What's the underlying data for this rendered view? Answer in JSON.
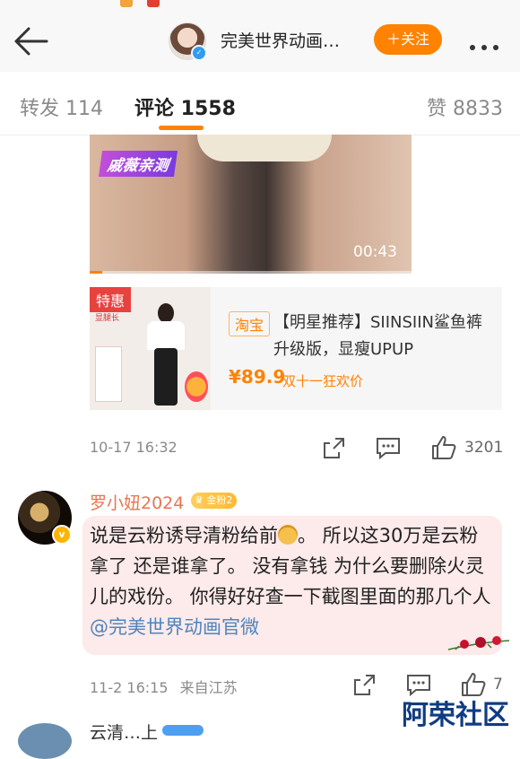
{
  "header": {
    "title": "完美世界动画…",
    "follow_label": "＋关注"
  },
  "tabs": [
    {
      "label": "转发 114"
    },
    {
      "label": "评论 1558"
    },
    {
      "label": "赞 8833"
    }
  ],
  "video": {
    "tag": "戚薇亲测",
    "duration": "00:43",
    "progress_fraction": 0.04
  },
  "product": {
    "badge": "特惠",
    "image_side_text": "显腿长",
    "platform": "淘宝",
    "title": "【明星推荐】SIINSIIN鲨鱼裤升级版，显瘦UPUP",
    "price": "¥89.9",
    "promo": "双十一狂欢价"
  },
  "post_meta": {
    "time": "10-17 16:32",
    "likes": "3201"
  },
  "comment": {
    "username": "罗小妞2024",
    "fan_badge": "金粉2",
    "text_before": "说是云粉诱导清粉给前",
    "text_after": "。 所以这30万是云粉拿了 还是谁拿了。 没有拿钱 为什么要删除火灵儿的戏份。 你得好好查一下截图里面的那几个人",
    "mention": "@完美世界动画官微",
    "time": "11-2 16:15",
    "location": "来自江苏",
    "likes": "7"
  },
  "reply_preview": {
    "username": "云清…上"
  },
  "watermark": "阿荣社区",
  "colors": {
    "accent": "#ff8200",
    "username": "#eb7350",
    "mention": "#4e85bd",
    "bubble": "#fdeaea"
  }
}
